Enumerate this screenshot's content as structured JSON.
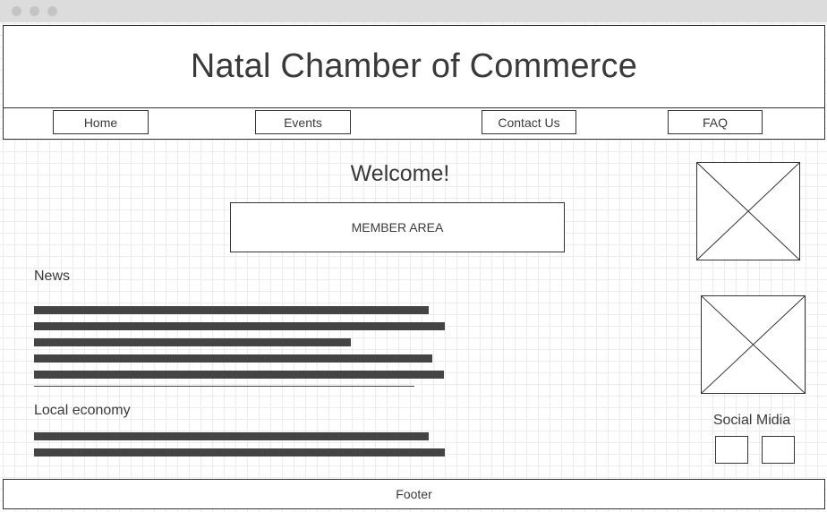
{
  "header": {
    "title": "Natal Chamber of Commerce"
  },
  "nav": {
    "items": [
      {
        "label": "Home"
      },
      {
        "label": "Events"
      },
      {
        "label": "Contact Us"
      },
      {
        "label": "FAQ"
      }
    ]
  },
  "main": {
    "welcome": "Welcome!",
    "member_area_label": "MEMBER AREA",
    "news": {
      "title": "News",
      "line_count": 5
    },
    "local_economy": {
      "title": "Local economy",
      "line_count": 2
    }
  },
  "sidebar": {
    "image_placeholders": [
      "image-placeholder-icon",
      "image-placeholder-icon"
    ],
    "social": {
      "title": "Social Midia",
      "button_count": 2
    }
  },
  "footer": {
    "label": "Footer"
  },
  "colors": {
    "titlebar": "#dcdcdc",
    "text": "#3a3a3a",
    "placeholder_bar": "#444444",
    "border": "#333333"
  }
}
